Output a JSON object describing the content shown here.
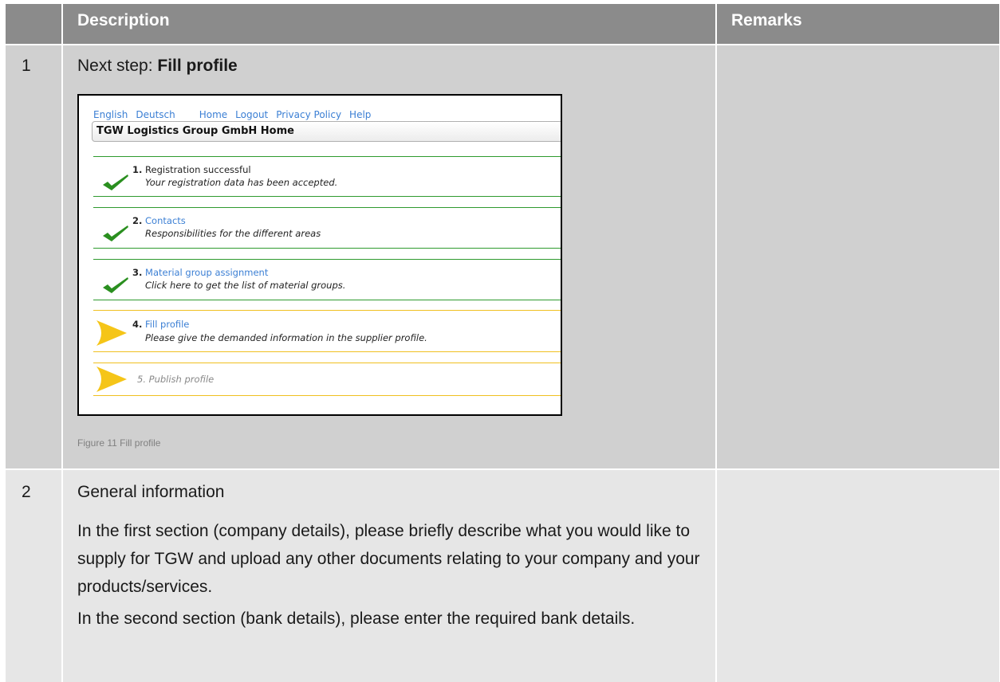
{
  "header": {
    "description": "Description",
    "remarks": "Remarks"
  },
  "rows": [
    {
      "number": "1",
      "title_prefix": "Next step: ",
      "title_bold": "Fill profile",
      "figure_caption": "Figure 11 Fill profile"
    },
    {
      "number": "2",
      "heading": "General information",
      "paragraphs": [
        "In the first section (company details), please briefly describe what you would like to supply for TGW and upload any other documents relating to your company and your products/services.",
        "In the second section (bank details), please enter the required bank details."
      ]
    }
  ],
  "screenshot": {
    "nav": [
      "English",
      "Deutsch",
      "Home",
      "Logout",
      "Privacy Policy",
      "Help"
    ],
    "title": "TGW Logistics Group GmbH Home",
    "steps": [
      {
        "num": "1.",
        "label": "Registration successful",
        "desc": "Your registration data has been accepted.",
        "status": "done",
        "linked": false
      },
      {
        "num": "2.",
        "label": "Contacts",
        "desc": "Responsibilities for the different areas",
        "status": "done",
        "linked": true
      },
      {
        "num": "3.",
        "label": "Material group assignment",
        "desc": "Click here to get the list of material groups.",
        "status": "done",
        "linked": true
      },
      {
        "num": "4.",
        "label": "Fill profile",
        "desc": "Please give the demanded information in the supplier profile.",
        "status": "current",
        "linked": true
      },
      {
        "num": "",
        "label": "5. Publish profile",
        "desc": "",
        "status": "pending",
        "linked": false
      }
    ],
    "icons": {
      "done": "checkmark-icon",
      "current": "arrow-right-icon",
      "pending": "arrow-right-icon"
    }
  },
  "colors": {
    "header_bg": "#8b8b8b",
    "row1_bg": "#d0d0d0",
    "row2_bg": "#e6e6e6",
    "link": "#3b7fd4",
    "done": "#2e9a2e",
    "current": "#f0c020"
  }
}
